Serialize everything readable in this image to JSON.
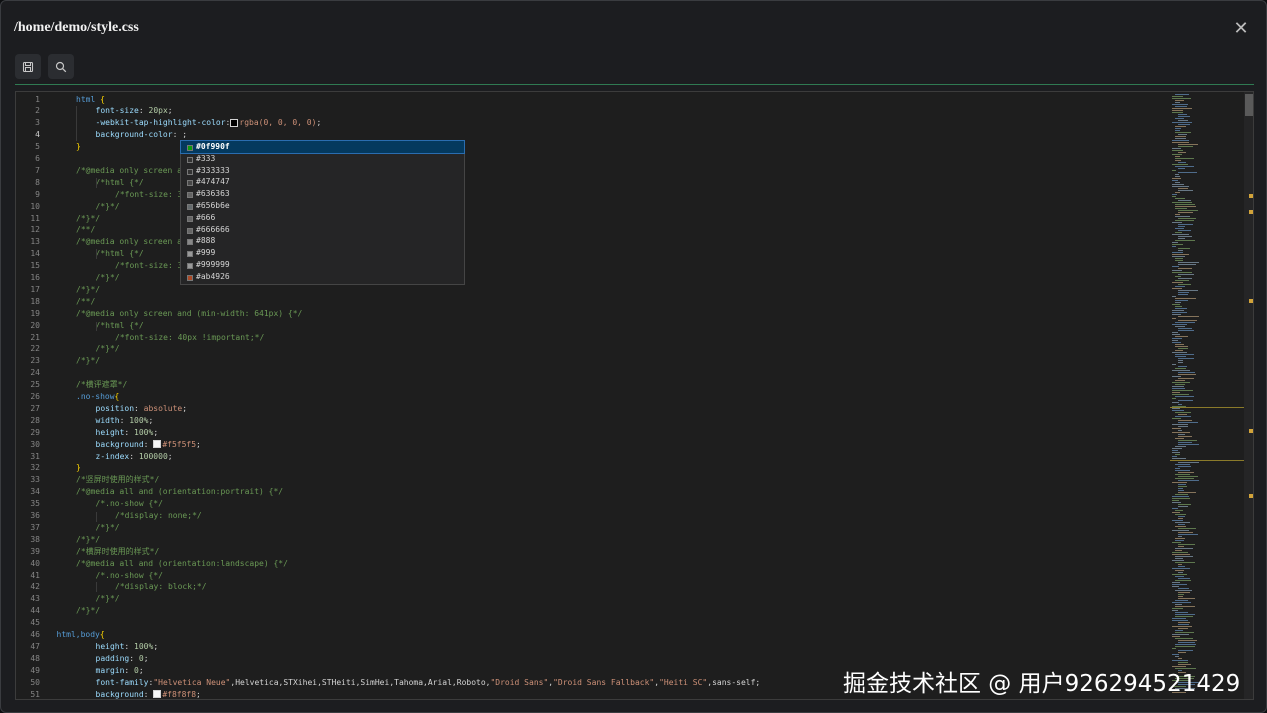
{
  "dialog": {
    "title": "/home/demo/style.css",
    "close_icon": "close-icon"
  },
  "toolbar": {
    "save_icon": "save-icon",
    "search_icon": "search-icon"
  },
  "colors": {
    "keyword": "#569cd6",
    "property": "#9cdcfe",
    "value": "#ce9178",
    "comment": "#6a9955",
    "punct": "#d4d4d4",
    "number": "#b5cea8",
    "string": "#ce9178",
    "brace": "#ffd700",
    "accent_rule": "#2f7a52"
  },
  "editor": {
    "current_line": 4,
    "lines": [
      {
        "n": "1",
        "i": 1,
        "t": [
          [
            "html ",
            "k"
          ],
          [
            "{",
            "b"
          ]
        ]
      },
      {
        "n": "2",
        "i": 2,
        "t": [
          [
            "font-size",
            "p"
          ],
          [
            ": ",
            "x"
          ],
          [
            "20px",
            "n"
          ],
          [
            ";",
            "x"
          ]
        ]
      },
      {
        "n": "3",
        "i": 2,
        "t": [
          [
            "-webkit-tap-highlight-color",
            "p"
          ],
          [
            ":",
            "x"
          ],
          [
            "rgba(0, 0, 0, 0)",
            "v"
          ],
          [
            ";",
            "x"
          ]
        ],
        "sw": {
          "after": 1,
          "c": "#000000"
        }
      },
      {
        "n": "4",
        "i": 2,
        "t": [
          [
            "background-color",
            "p"
          ],
          [
            ": ;",
            "x"
          ]
        ]
      },
      {
        "n": "5",
        "i": 1,
        "t": [
          [
            "}",
            "b"
          ]
        ]
      },
      {
        "n": "6",
        "i": 0,
        "t": []
      },
      {
        "n": "7",
        "i": 1,
        "t": [
          [
            "/*@media only screen a",
            "c"
          ]
        ]
      },
      {
        "n": "8",
        "i": 2,
        "t": [
          [
            "/*html {*/",
            "c"
          ]
        ]
      },
      {
        "n": "9",
        "i": 3,
        "t": [
          [
            "/*font-size: 3",
            "c"
          ]
        ]
      },
      {
        "n": "10",
        "i": 2,
        "t": [
          [
            "/*}*/",
            "c"
          ]
        ]
      },
      {
        "n": "11",
        "i": 1,
        "t": [
          [
            "/*}*/",
            "c"
          ]
        ]
      },
      {
        "n": "12",
        "i": 1,
        "t": [
          [
            "/**/",
            "c"
          ]
        ]
      },
      {
        "n": "13",
        "i": 1,
        "t": [
          [
            "/*@media only screen a",
            "c"
          ]
        ]
      },
      {
        "n": "14",
        "i": 2,
        "t": [
          [
            "/*html {*/",
            "c"
          ]
        ]
      },
      {
        "n": "15",
        "i": 3,
        "t": [
          [
            "/*font-size: 3",
            "c"
          ]
        ]
      },
      {
        "n": "16",
        "i": 2,
        "t": [
          [
            "/*}*/",
            "c"
          ]
        ]
      },
      {
        "n": "17",
        "i": 1,
        "t": [
          [
            "/*}*/",
            "c"
          ]
        ]
      },
      {
        "n": "18",
        "i": 1,
        "t": [
          [
            "/**/",
            "c"
          ]
        ]
      },
      {
        "n": "19",
        "i": 1,
        "t": [
          [
            "/*@media only screen and (min-width: 641px) {*/",
            "c"
          ]
        ]
      },
      {
        "n": "20",
        "i": 2,
        "t": [
          [
            "/*html {*/",
            "c"
          ]
        ]
      },
      {
        "n": "21",
        "i": 3,
        "t": [
          [
            "/*font-size: 40px !important;*/",
            "c"
          ]
        ]
      },
      {
        "n": "22",
        "i": 2,
        "t": [
          [
            "/*}*/",
            "c"
          ]
        ]
      },
      {
        "n": "23",
        "i": 1,
        "t": [
          [
            "/*}*/",
            "c"
          ]
        ]
      },
      {
        "n": "24",
        "i": 0,
        "t": []
      },
      {
        "n": "25",
        "i": 1,
        "t": [
          [
            "/*横评遮罩*/",
            "c"
          ]
        ]
      },
      {
        "n": "26",
        "i": 1,
        "t": [
          [
            ".no-show",
            "k"
          ],
          [
            "{",
            "b"
          ]
        ]
      },
      {
        "n": "27",
        "i": 2,
        "t": [
          [
            "position",
            "p"
          ],
          [
            ": ",
            "x"
          ],
          [
            "absolute",
            "v"
          ],
          [
            ";",
            "x"
          ]
        ]
      },
      {
        "n": "28",
        "i": 2,
        "t": [
          [
            "width",
            "p"
          ],
          [
            ": ",
            "x"
          ],
          [
            "100%",
            "n"
          ],
          [
            ";",
            "x"
          ]
        ]
      },
      {
        "n": "29",
        "i": 2,
        "t": [
          [
            "height",
            "p"
          ],
          [
            ": ",
            "x"
          ],
          [
            "100%",
            "n"
          ],
          [
            ";",
            "x"
          ]
        ]
      },
      {
        "n": "30",
        "i": 2,
        "t": [
          [
            "background",
            "p"
          ],
          [
            ": ",
            "x"
          ],
          [
            "#f5f5f5",
            "v"
          ],
          [
            ";",
            "x"
          ]
        ],
        "sw": {
          "after": 1,
          "c": "#f5f5f5"
        }
      },
      {
        "n": "31",
        "i": 2,
        "t": [
          [
            "z-index",
            "p"
          ],
          [
            ": ",
            "x"
          ],
          [
            "100000",
            "n"
          ],
          [
            ";",
            "x"
          ]
        ]
      },
      {
        "n": "32",
        "i": 1,
        "t": [
          [
            "}",
            "b"
          ]
        ]
      },
      {
        "n": "33",
        "i": 1,
        "t": [
          [
            "/*竖屏时使用的样式*/",
            "c"
          ]
        ]
      },
      {
        "n": "34",
        "i": 1,
        "t": [
          [
            "/*@media all and (orientation:portrait) {*/",
            "c"
          ]
        ]
      },
      {
        "n": "35",
        "i": 2,
        "t": [
          [
            "/*.no-show {*/",
            "c"
          ]
        ]
      },
      {
        "n": "36",
        "i": 3,
        "t": [
          [
            "/*display: none;*/",
            "c"
          ]
        ]
      },
      {
        "n": "37",
        "i": 2,
        "t": [
          [
            "/*}*/",
            "c"
          ]
        ]
      },
      {
        "n": "38",
        "i": 1,
        "t": [
          [
            "/*}*/",
            "c"
          ]
        ]
      },
      {
        "n": "39",
        "i": 1,
        "t": [
          [
            "/*横屏时使用的样式*/",
            "c"
          ]
        ]
      },
      {
        "n": "40",
        "i": 1,
        "t": [
          [
            "/*@media all and (orientation:landscape) {*/",
            "c"
          ]
        ]
      },
      {
        "n": "41",
        "i": 2,
        "t": [
          [
            "/*.no-show {*/",
            "c"
          ]
        ]
      },
      {
        "n": "42",
        "i": 3,
        "t": [
          [
            "/*display: block;*/",
            "c"
          ]
        ]
      },
      {
        "n": "43",
        "i": 2,
        "t": [
          [
            "/*}*/",
            "c"
          ]
        ]
      },
      {
        "n": "44",
        "i": 1,
        "t": [
          [
            "/*}*/",
            "c"
          ]
        ]
      },
      {
        "n": "45",
        "i": 0,
        "t": []
      },
      {
        "n": "46",
        "i": 0,
        "t": [
          [
            "html,body",
            "k"
          ],
          [
            "{",
            "b"
          ]
        ]
      },
      {
        "n": "47",
        "i": 2,
        "t": [
          [
            "height",
            "p"
          ],
          [
            ": ",
            "x"
          ],
          [
            "100%",
            "n"
          ],
          [
            ";",
            "x"
          ]
        ]
      },
      {
        "n": "48",
        "i": 2,
        "t": [
          [
            "padding",
            "p"
          ],
          [
            ": ",
            "x"
          ],
          [
            "0",
            "n"
          ],
          [
            ";",
            "x"
          ]
        ]
      },
      {
        "n": "49",
        "i": 2,
        "t": [
          [
            "margin",
            "p"
          ],
          [
            ": ",
            "x"
          ],
          [
            "0",
            "n"
          ],
          [
            ";",
            "x"
          ]
        ]
      },
      {
        "n": "50",
        "i": 2,
        "t": [
          [
            "font-family",
            "p"
          ],
          [
            ":",
            "x"
          ],
          [
            "\"Helvetica Neue\"",
            "s"
          ],
          [
            ",Helvetica,STXihei,STHeiti,SimHei,Tahoma,Arial,Roboto,",
            "x"
          ],
          [
            "\"Droid Sans\"",
            "s"
          ],
          [
            ",",
            "x"
          ],
          [
            "\"Droid Sans Fallback\"",
            "s"
          ],
          [
            ",",
            "x"
          ],
          [
            "\"Heiti SC\"",
            "s"
          ],
          [
            ",sans-self;",
            "x"
          ]
        ]
      },
      {
        "n": "51",
        "i": 2,
        "t": [
          [
            "background",
            "p"
          ],
          [
            ": ",
            "x"
          ],
          [
            "#f8f8f8",
            "v"
          ],
          [
            ";",
            "x"
          ]
        ],
        "sw": {
          "after": 1,
          "c": "#f8f8f8"
        }
      }
    ]
  },
  "suggest": {
    "selected": 0,
    "items": [
      {
        "label": "#0f990f",
        "color": "#0f990f"
      },
      {
        "label": "#333",
        "color": "#333333"
      },
      {
        "label": "#333333",
        "color": "#333333"
      },
      {
        "label": "#474747",
        "color": "#474747"
      },
      {
        "label": "#636363",
        "color": "#636363"
      },
      {
        "label": "#656b6e",
        "color": "#656b6e"
      },
      {
        "label": "#666",
        "color": "#666666"
      },
      {
        "label": "#666666",
        "color": "#666666"
      },
      {
        "label": "#888",
        "color": "#888888"
      },
      {
        "label": "#999",
        "color": "#999999"
      },
      {
        "label": "#999999",
        "color": "#999999"
      },
      {
        "label": "#ab4926",
        "color": "#ab4926"
      }
    ]
  },
  "watermark": "掘金技术社区 @ 用户926294521429"
}
